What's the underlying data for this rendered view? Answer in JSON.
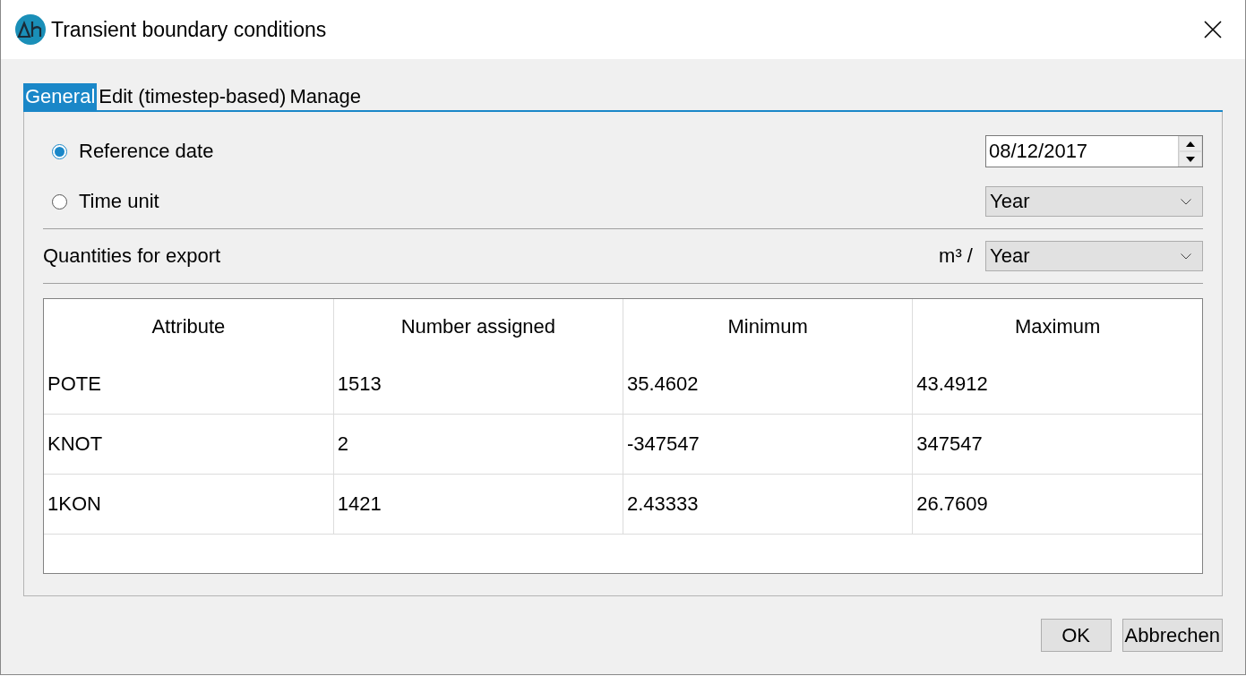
{
  "window": {
    "title": "Transient boundary conditions"
  },
  "tabs": [
    {
      "label": "General",
      "selected": true
    },
    {
      "label": "Edit (timestep-based)",
      "selected": false
    },
    {
      "label": "Manage",
      "selected": false
    }
  ],
  "options": [
    {
      "label": "Reference date",
      "selected": true,
      "kind": "spin",
      "value": "08/12/2017"
    },
    {
      "label": "Time unit",
      "selected": false,
      "kind": "dropdown",
      "value": "Year"
    }
  ],
  "export": {
    "label": "Quantities for export",
    "unit": "m³ /",
    "value": "Year"
  },
  "table": {
    "columns": [
      "Attribute",
      "Number assigned",
      "Minimum",
      "Maximum"
    ],
    "rows": [
      [
        "POTE",
        "1513",
        "35.4602",
        "43.4912"
      ],
      [
        "KNOT",
        "2",
        "-347547",
        "347547"
      ],
      [
        "1KON",
        "1421",
        "2.43333",
        "26.7609"
      ]
    ]
  },
  "buttons": [
    "OK",
    "Abbrechen"
  ]
}
